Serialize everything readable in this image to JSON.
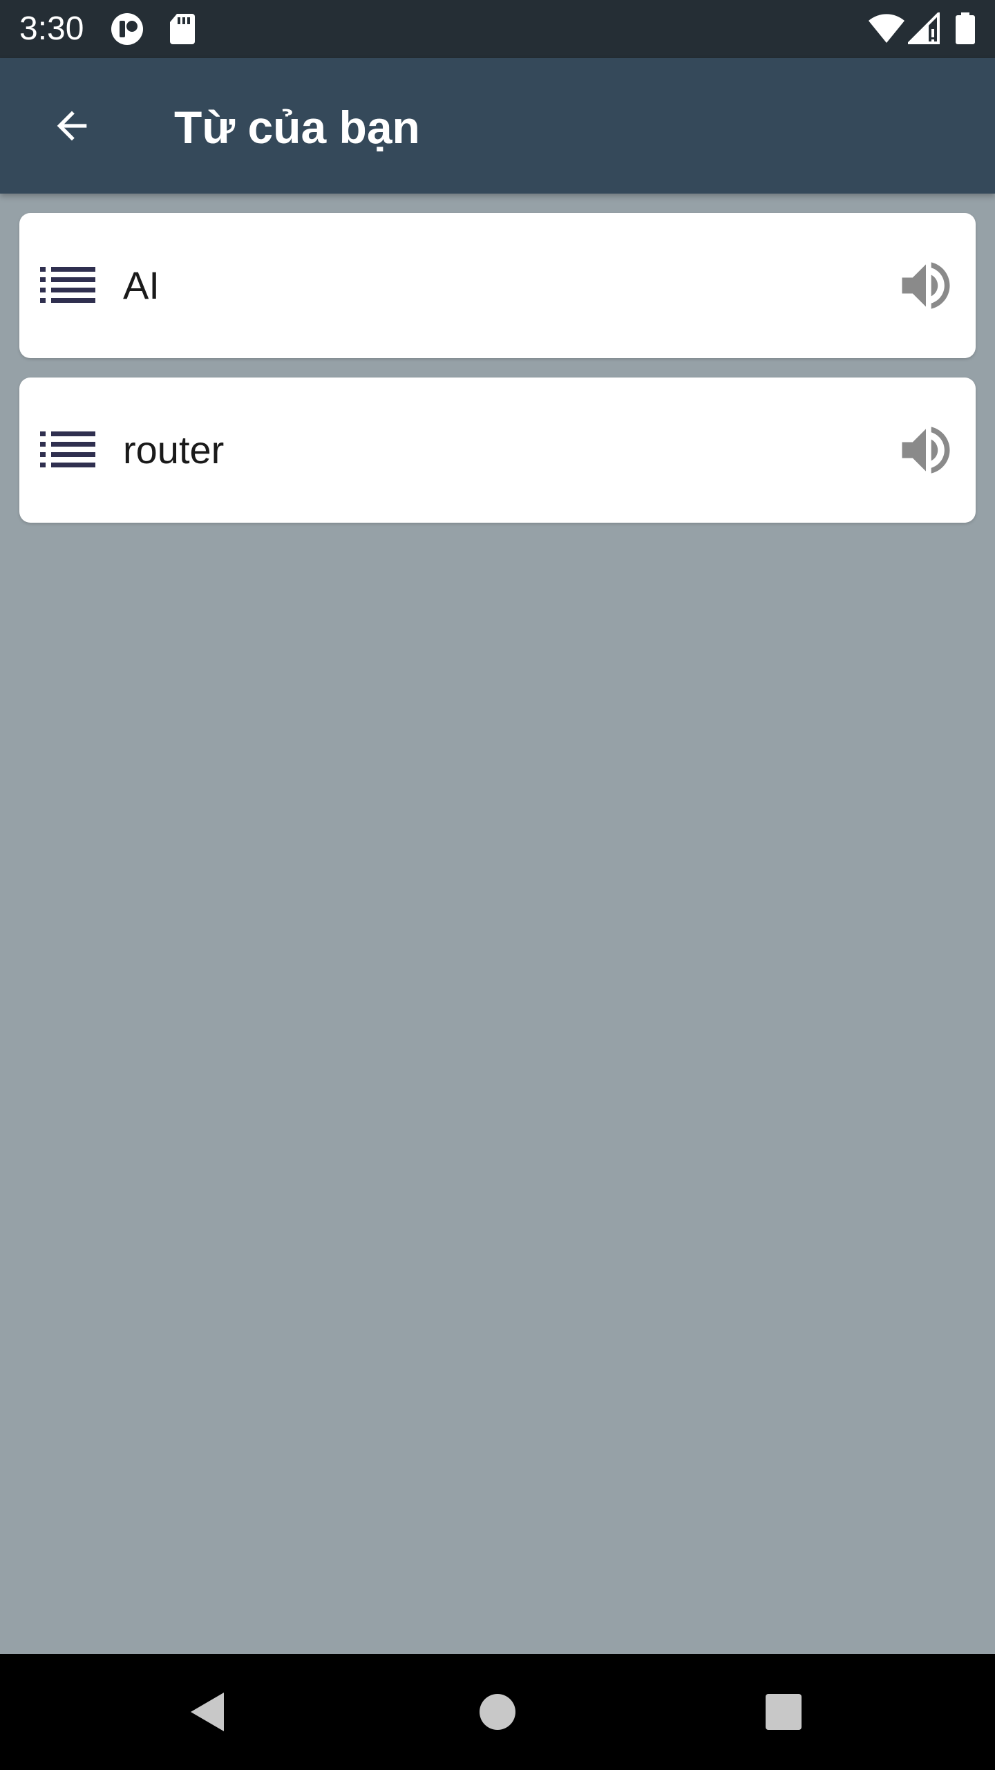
{
  "status_bar": {
    "time": "3:30",
    "left_icons": [
      "app-notification-icon",
      "sd-card-icon"
    ],
    "right_icons": [
      "wifi-icon",
      "cellular-signal-icon",
      "battery-icon"
    ]
  },
  "app_bar": {
    "back_icon": "arrow-back-icon",
    "title": "Từ của bạn"
  },
  "words": [
    {
      "text": "AI",
      "leading_icon": "list-icon",
      "action_icon": "volume-up-icon"
    },
    {
      "text": "router",
      "leading_icon": "list-icon",
      "action_icon": "volume-up-icon"
    }
  ],
  "nav_bar": {
    "buttons": [
      "back-triangle-icon",
      "home-circle-icon",
      "recents-square-icon"
    ]
  },
  "colors": {
    "status_bar": "#252e35",
    "app_bar": "#35495a",
    "background": "#96a1a7",
    "card": "#ffffff",
    "list_icon": "#2f2f4f",
    "speaker_icon": "#8a8a8a",
    "nav_bar": "#000000"
  }
}
